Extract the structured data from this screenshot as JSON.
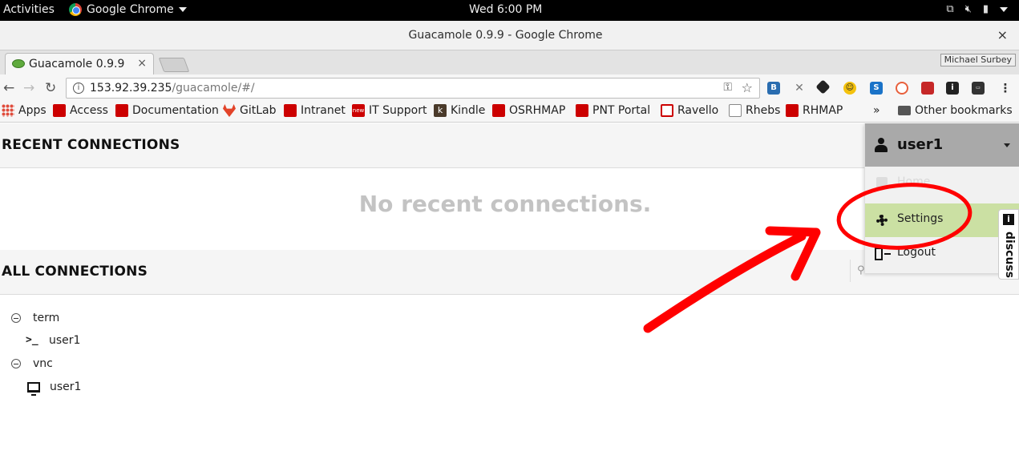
{
  "system_bar": {
    "activities": "Activities",
    "app_name": "Google Chrome",
    "clock": "Wed  6:00 PM"
  },
  "window": {
    "title": "Guacamole 0.9.9 - Google Chrome",
    "close": "×"
  },
  "tabs": [
    {
      "label": "Guacamole 0.9.9",
      "close": "×"
    }
  ],
  "profile_name": "Michael Surbey",
  "address_bar": {
    "info": "i",
    "host": "153.92.39.235",
    "path": "/guacamole/#/"
  },
  "bookmarks": [
    {
      "label": "Apps",
      "icon": "apps-grid-icon"
    },
    {
      "label": "Access",
      "icon": "redhat-icon"
    },
    {
      "label": "Documentation",
      "icon": "redhat-icon"
    },
    {
      "label": "GitLab",
      "icon": "gitlab-icon"
    },
    {
      "label": "Intranet",
      "icon": "redhat-icon"
    },
    {
      "label": "IT Support",
      "icon": "new-icon",
      "icon_text": "new"
    },
    {
      "label": "Kindle",
      "icon": "kindle-icon",
      "icon_text": "k"
    },
    {
      "label": "OSRHMAP",
      "icon": "redhat-icon"
    },
    {
      "label": "PNT Portal",
      "icon": "redhat-icon"
    },
    {
      "label": "Ravello",
      "icon": "ravello-icon"
    },
    {
      "label": "Rhebs",
      "icon": "page-icon"
    },
    {
      "label": "RHMAP",
      "icon": "redhat-icon"
    }
  ],
  "bookmarks_overflow": "»",
  "other_bookmarks": "Other bookmarks",
  "page": {
    "recent_header": "RECENT CONNECTIONS",
    "no_recent": "No recent connections.",
    "all_header": "ALL CONNECTIONS",
    "tree": [
      {
        "group": "term",
        "children": [
          {
            "name": "user1",
            "protocol": "ssh"
          }
        ]
      },
      {
        "group": "vnc",
        "children": [
          {
            "name": "user1",
            "protocol": "vnc"
          }
        ]
      }
    ]
  },
  "user_menu": {
    "username": "user1",
    "items": {
      "home": "Home",
      "settings": "Settings",
      "logout": "Logout"
    }
  },
  "discuss_tab": {
    "label": "discuss",
    "icon_text": "i"
  },
  "annotation": {
    "color": "#ff0000"
  }
}
